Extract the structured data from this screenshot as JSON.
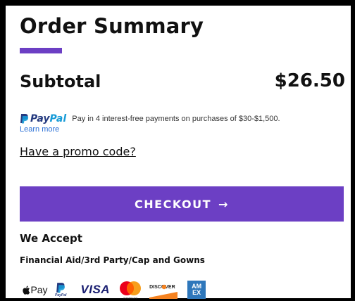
{
  "order_summary": {
    "title": "Order Summary",
    "accent_color": "#6c3fc4"
  },
  "subtotal": {
    "label": "Subtotal",
    "value": "$26.50"
  },
  "paypal": {
    "brand_first": "Pay",
    "brand_second": "Pal",
    "message": "Pay in 4 interest-free payments on purchases of $30-$1,500.",
    "learn_more": "Learn more"
  },
  "promo": {
    "label": "Have a promo code?"
  },
  "checkout": {
    "label": "CHECKOUT",
    "arrow": "→"
  },
  "we_accept": {
    "title": "We Accept",
    "financial_aid": "Financial Aid/3rd Party/Cap and Gowns",
    "methods": {
      "apple_pay": "Pay",
      "paypal_small": "PayPal",
      "visa": "VISA",
      "mastercard": "mastercard",
      "discover": "DISCOVER",
      "amex_top": "AM",
      "amex_bottom": "EX"
    }
  }
}
